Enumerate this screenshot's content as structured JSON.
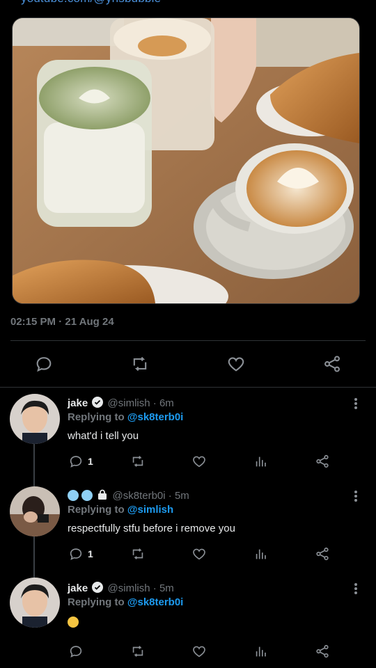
{
  "tweet": {
    "top_link": "youtube.com/@ynsbubble",
    "timestamp": "02:15 PM · 21 Aug 24"
  },
  "icons": {
    "reply": "reply-icon",
    "retweet": "retweet-icon",
    "like": "heart-icon",
    "views": "views-icon",
    "share": "share-icon",
    "more": "more-icon"
  },
  "colors": {
    "background": "#000000",
    "link": "#1d9bf0",
    "muted": "#71767b",
    "text": "#e7e9ea",
    "divider": "#2f3336"
  },
  "replies": [
    {
      "display_name": "jake",
      "handle": "@simlish",
      "sep": "·",
      "time": "6m",
      "replying_prefix": "Replying to",
      "replying_to": "@sk8terb0i",
      "text": "what'd i tell you",
      "reply_count": "1"
    },
    {
      "display_name": "",
      "handle": "@sk8terb0i",
      "sep": "·",
      "time": "5m",
      "replying_prefix": "Replying to",
      "replying_to": "@simlish",
      "text": "respectfully stfu before i remove you",
      "reply_count": "1"
    },
    {
      "display_name": "jake",
      "handle": "@simlish",
      "sep": "·",
      "time": "5m",
      "replying_prefix": "Replying to",
      "replying_to": "@sk8terb0i",
      "text": "",
      "reply_count": ""
    }
  ]
}
